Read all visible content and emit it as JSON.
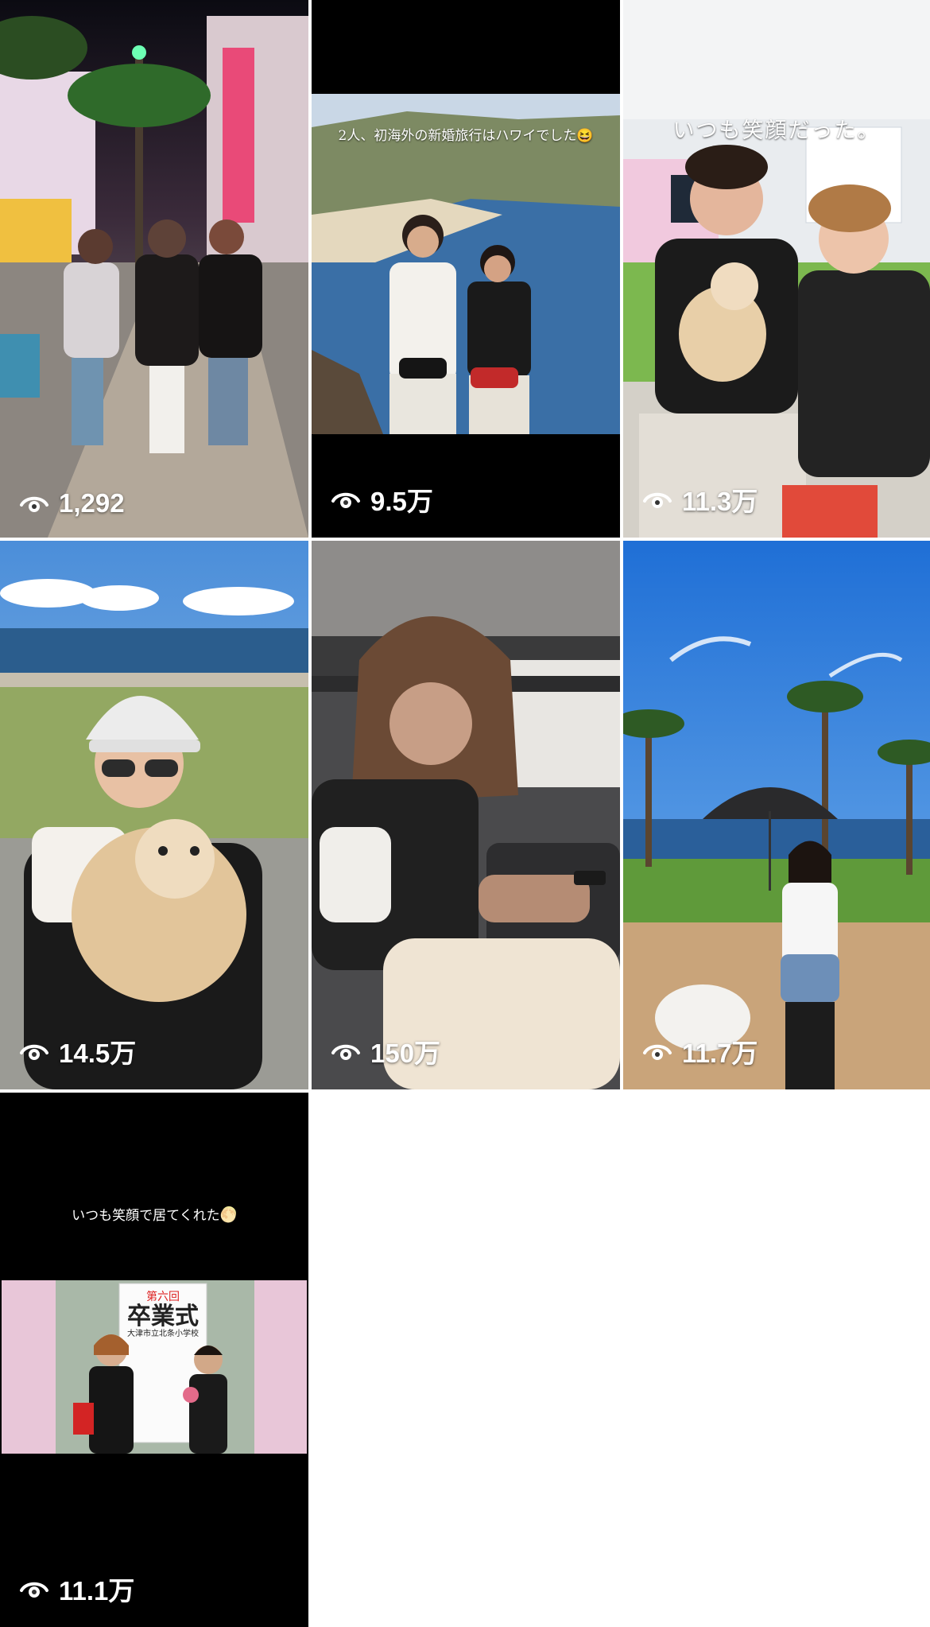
{
  "grid": {
    "tiles": [
      {
        "views": "1,292",
        "caption": ""
      },
      {
        "views": "9.5万",
        "caption": "2人、初海外の新婚旅行はハワイでした😆"
      },
      {
        "views": "11.3万",
        "caption": "いつも笑顔だった。"
      },
      {
        "views": "14.5万",
        "caption": ""
      },
      {
        "views": "150万",
        "caption": ""
      },
      {
        "views": "11.7万",
        "caption": ""
      },
      {
        "views": "11.1万",
        "caption": "いつも笑顔で居てくれた🌕",
        "sign_lines": [
          "第六回",
          "卒業式",
          "大津市立北条小学校"
        ]
      }
    ]
  },
  "icons": {
    "view_count": "eye-icon"
  },
  "colors": {
    "view_text": "#ffffff",
    "tile_bg": "#000000",
    "page_bg": "#ffffff"
  }
}
